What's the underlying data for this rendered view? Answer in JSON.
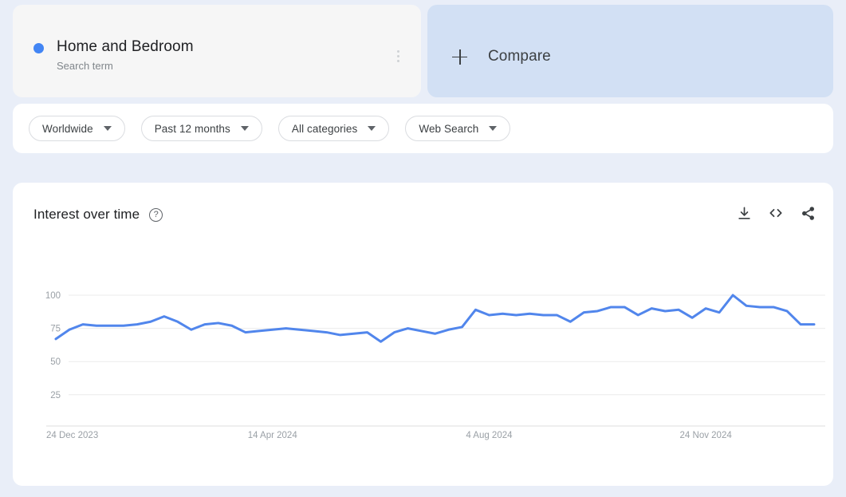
{
  "term": {
    "title": "Home and Bedroom",
    "subtitle": "Search term",
    "dot_color": "#4285f4",
    "menu_icon": "kebab-menu-icon"
  },
  "compare": {
    "label": "Compare",
    "icon": "plus-icon",
    "bg_color": "#d2e0f4"
  },
  "filters": [
    {
      "label": "Worldwide"
    },
    {
      "label": "Past 12 months"
    },
    {
      "label": "All categories"
    },
    {
      "label": "Web Search"
    }
  ],
  "chart_card": {
    "title": "Interest over time",
    "help_icon": "help-circle-icon",
    "actions": [
      {
        "name": "download-icon"
      },
      {
        "name": "embed-code-icon"
      },
      {
        "name": "share-icon"
      }
    ]
  },
  "chart_data": {
    "type": "line",
    "title": "Interest over time",
    "xlabel": "",
    "ylabel": "",
    "ylim": [
      0,
      105
    ],
    "yticks": [
      25,
      50,
      75,
      100
    ],
    "grid": true,
    "legend": false,
    "line_color": "#5186ec",
    "xtick_labels": [
      "24 Dec 2023",
      "14 Apr 2024",
      "4 Aug 2024",
      "24 Nov 2024"
    ],
    "xtick_positions": [
      0,
      16,
      32,
      48
    ],
    "series": [
      {
        "name": "Home and Bedroom",
        "values": [
          67,
          74,
          78,
          77,
          77,
          77,
          78,
          80,
          84,
          80,
          74,
          78,
          79,
          77,
          72,
          73,
          74,
          75,
          74,
          73,
          72,
          70,
          71,
          72,
          65,
          72,
          75,
          73,
          71,
          74,
          76,
          89,
          85,
          86,
          85,
          86,
          85,
          85,
          80,
          87,
          88,
          91,
          91,
          85,
          90,
          88,
          89,
          83,
          90,
          87,
          100,
          92,
          91,
          91,
          88,
          78,
          78
        ]
      }
    ]
  }
}
